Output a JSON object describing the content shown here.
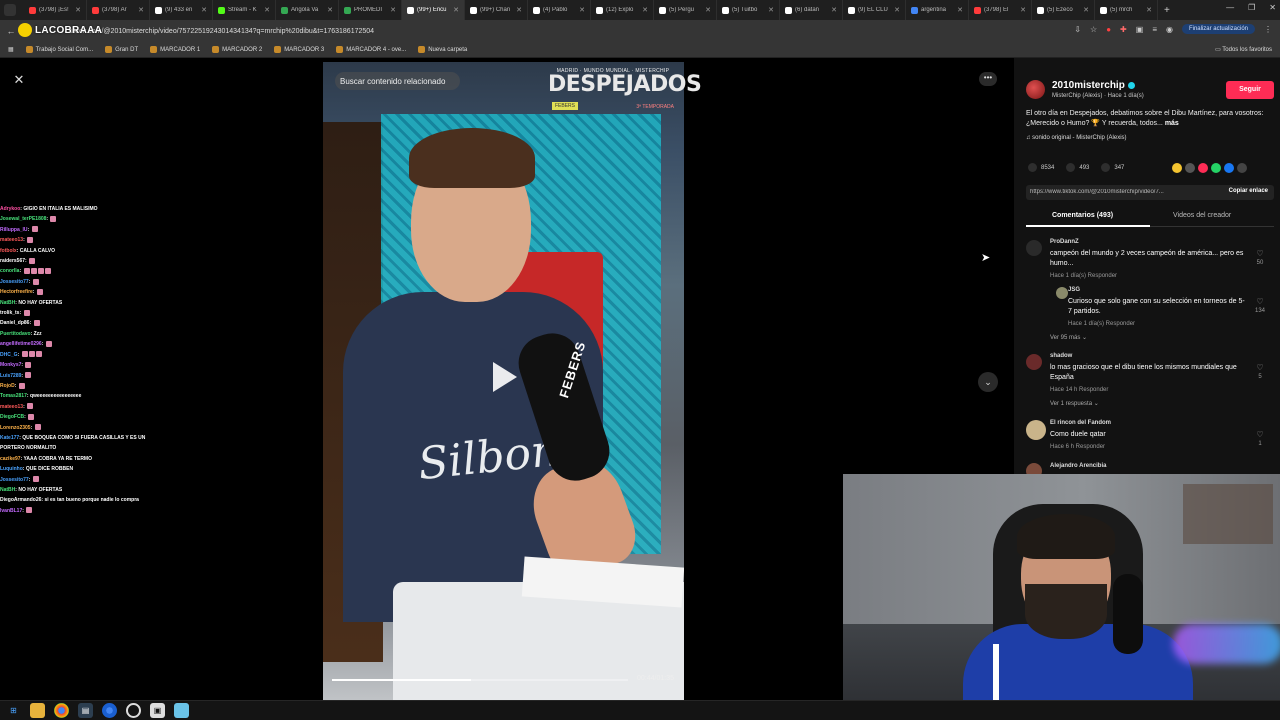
{
  "browser": {
    "tabs": [
      {
        "title": "(3798) ¡Es!",
        "color": "#ff3b3b"
      },
      {
        "title": "(3798) Ar",
        "color": "#ff3b3b"
      },
      {
        "title": "(9) 433 en",
        "color": "#ffffff"
      },
      {
        "title": "Stream - K",
        "color": "#53fc18"
      },
      {
        "title": "Angola Va",
        "color": "#34a853"
      },
      {
        "title": "PROMEDI",
        "color": "#34a853"
      },
      {
        "title": "(99+) Encu",
        "color": "#ffffff",
        "active": true
      },
      {
        "title": "(99+) Chan",
        "color": "#ffffff"
      },
      {
        "title": "(4) Pablo",
        "color": "#ffffff"
      },
      {
        "title": "(12) Explo",
        "color": "#ffffff"
      },
      {
        "title": "(5) Pergu",
        "color": "#ffffff"
      },
      {
        "title": "(5) Tuitbo",
        "color": "#ffffff"
      },
      {
        "title": "(6) datan",
        "color": "#ffffff"
      },
      {
        "title": "(9) EL CLU",
        "color": "#ffffff"
      },
      {
        "title": "argentina",
        "color": "#4285f4"
      },
      {
        "title": "(3798) El",
        "color": "#ff3b3b"
      },
      {
        "title": "(5) Ezeco",
        "color": "#ffffff"
      },
      {
        "title": "(5) mrch",
        "color": "#ffffff"
      }
    ],
    "url": "tiktok.com/@2010misterchip/video/7572251924301434134?q=mrchip%20dibu&t=1763186172504",
    "stream_logo": "LACOBRAAA",
    "update_button": "Finalizar actualización",
    "bookmarks": [
      "Trabajo Social Com...",
      "Gran DT",
      "MARCADOR 1",
      "MARCADOR 2",
      "MARCADOR 3",
      "MARCADOR 4 - ove...",
      "Nueva carpeta"
    ],
    "all_favorites": "Todos los favoritos"
  },
  "video": {
    "search_related": "Buscar contenido relacionado",
    "brand_top": "MADRID · MUNDO MUNDIAL · MISTERCHIP",
    "brand_main": "DESPEJADOS",
    "brand_tag": "FEBERS",
    "brand_season": "3ª TEMPORADA",
    "shirt_text": "Silbon",
    "mic_label": "FEBERS",
    "timecode": "00:44/01:35",
    "progress": 0.47
  },
  "chat": [
    {
      "user": "Adrykoo",
      "msg": "GIGIO EN ITALIA ES MALISIMO",
      "color": "#ff4fa3"
    },
    {
      "user": "Josewal_terPE1808",
      "msg": "",
      "color": "#48e07a",
      "emotes": 1
    },
    {
      "user": "Rilluppa_lU",
      "msg": "",
      "color": "#c46bff",
      "emotes": 1
    },
    {
      "user": "mateeo13",
      "msg": "",
      "color": "#ff5a5a",
      "emotes": 1
    },
    {
      "user": "fotbolx",
      "msg": "CALLA CALVO",
      "color": "#ff5a5a"
    },
    {
      "user": "raiders567",
      "msg": "",
      "color": "#ffffff",
      "emotes": 1
    },
    {
      "user": "conorlla",
      "msg": "",
      "color": "#48e07a",
      "emotes": 4
    },
    {
      "user": "Jossesito77",
      "msg": "",
      "color": "#4aa3ff",
      "emotes": 1
    },
    {
      "user": "Hectorfreefire",
      "msg": "",
      "color": "#ffb34a",
      "emotes": 1
    },
    {
      "user": "NatBH",
      "msg": "NO HAY OFERTAS",
      "color": "#48e07a"
    },
    {
      "user": "trolik_ts",
      "msg": "",
      "color": "#ffffff",
      "emotes": 1
    },
    {
      "user": "Daniel_dp86",
      "msg": "",
      "color": "#ffffff",
      "emotes": 1
    },
    {
      "user": "Puertitodavo",
      "msg": "Zzz",
      "color": "#48e07a"
    },
    {
      "user": "angellifetime0296",
      "msg": "",
      "color": "#c46bff",
      "emotes": 1
    },
    {
      "user": "DHC_G",
      "msg": "",
      "color": "#4aa3ff",
      "emotes": 3
    },
    {
      "user": "Monkys7",
      "msg": "",
      "color": "#c46bff",
      "emotes": 1
    },
    {
      "user": "Luis7289",
      "msg": "",
      "color": "#4aa3ff",
      "emotes": 1
    },
    {
      "user": "RojoD",
      "msg": "",
      "color": "#ffb34a",
      "emotes": 1
    },
    {
      "user": "Tomas2817",
      "msg": "qweeeeeeeeeeeeeeee",
      "color": "#48e07a"
    },
    {
      "user": "mateeo13",
      "msg": "",
      "color": "#ff5a5a",
      "emotes": 1
    },
    {
      "user": "DiegoFCB",
      "msg": "",
      "color": "#48e07a",
      "emotes": 1
    },
    {
      "user": "Lorenzo2305",
      "msg": "",
      "color": "#ffb34a",
      "emotes": 1
    },
    {
      "user": "Kate177",
      "msg": "QUE BOQUEA COMO SI FUERA CASILLAS Y ES UN",
      "color": "#4aa3ff"
    },
    {
      "user": "",
      "msg": "PORTERO NORMALITO",
      "color": "#ffffff"
    },
    {
      "user": "cazike97",
      "msg": "YAAA COBRA YA RE TERMO",
      "color": "#ffb34a"
    },
    {
      "user": "Luquinho",
      "msg": "QUE DICE ROBBEN",
      "color": "#4aa3ff"
    },
    {
      "user": "Jossesito77",
      "msg": "",
      "color": "#4aa3ff",
      "emotes": 1
    },
    {
      "user": "NatBH",
      "msg": "NO HAY OFERTAS",
      "color": "#48e07a"
    },
    {
      "user": "DiegoArmando26",
      "msg": "si es tan bueno porque nadie lo compra",
      "color": "#ffffff"
    },
    {
      "user": "IvanBL17",
      "msg": "",
      "color": "#c46bff",
      "emotes": 1
    }
  ],
  "panel": {
    "author_name": "2010misterchip",
    "author_sub": "MisterChip (Alexis) · Hace 1 día(s)",
    "follow": "Seguir",
    "description": "El otro día en Despejados, debatimos sobre el Dibu Martínez, para vosotros: ¿Merecido o Humo? 🏆 Y recuerda, todos...",
    "description_more": "más",
    "sound": "♫  sonido original - MisterChip (Alexis)",
    "likes": "8534",
    "comments": "493",
    "saves": "347",
    "share_colors": [
      "#f4c430",
      "#555555",
      "#fe2c55",
      "#25d366",
      "#1877f2",
      "#444444"
    ],
    "link": "https://www.tiktok.com/@2010misterchip/video/7...",
    "copy_link": "Copiar enlace",
    "tab_comments": "Comentarios (493)",
    "tab_videos": "Videos del creador"
  },
  "comments": [
    {
      "user": "ProDannZ",
      "text": "campeón del mundo y 2 veces campeón de américa... pero es humo...",
      "meta": "Hace 1 día(s)     Responder",
      "likes": "50",
      "avatar": "#2a2a2a"
    },
    {
      "user": "JSG",
      "text": "Curioso que solo gane con su selección en torneos de 5-7 partidos.",
      "meta": "Hace 1 día(s)     Responder",
      "likes": "134",
      "avatar": "#8a8a6a",
      "reply": true
    },
    {
      "user": "shadow",
      "text": "lo mas gracioso que el dibu tiene los mismos mundiales que España",
      "meta": "Hace 14 h     Responder",
      "likes": "5",
      "avatar": "#6a2a2a"
    },
    {
      "user": "El rincon del Fandom",
      "text": "Como duele qatar",
      "meta": "Hace 6 h     Responder",
      "likes": "1",
      "avatar": "#c9b48a"
    },
    {
      "user": "Alejandro Arencibia",
      "text": "",
      "meta": "",
      "likes": "",
      "avatar": "#7a4a3a"
    }
  ],
  "more_replies": {
    "first": "Ver 95 más ⌄",
    "second": "Ver 1 respuesta ⌄"
  }
}
